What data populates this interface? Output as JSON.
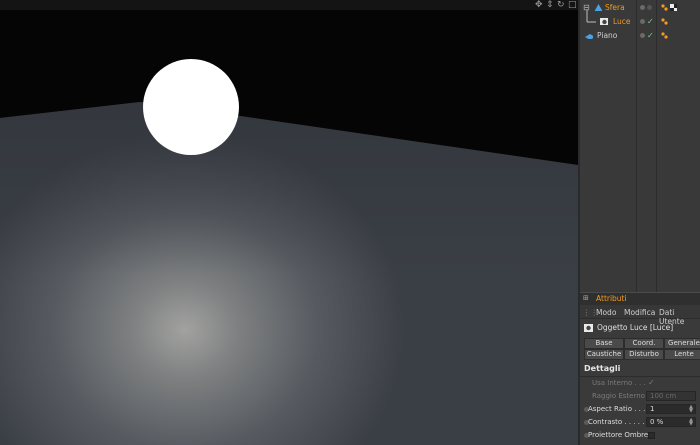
{
  "objects": [
    {
      "name": "Sfera",
      "selected": true,
      "color": "#f29b1d"
    },
    {
      "name": "Luce",
      "selected": true,
      "color": "#f29b1d"
    },
    {
      "name": "Piano",
      "selected": false,
      "color": "#cfcfcf"
    }
  ],
  "attributes": {
    "panel_title": "Attributi",
    "menu": [
      "Modo",
      "Modifica",
      "Dati Utente"
    ],
    "object_title": "Oggetto Luce [Luce]",
    "tabs_row1": [
      "Base",
      "Coord.",
      "Generale"
    ],
    "tabs_row2": [
      "Caustiche",
      "Disturbo",
      "Lente"
    ],
    "section": "Dettagli",
    "params": [
      {
        "label": "Usa Interno . . .",
        "kind": "check",
        "value": "✓",
        "enabled": false
      },
      {
        "label": "Raggio Esterno",
        "kind": "field",
        "value": "100 cm",
        "enabled": false
      },
      {
        "label": "Aspect Ratio . . .",
        "kind": "field",
        "value": "1",
        "enabled": true
      },
      {
        "label": "Contrasto . . . . .",
        "kind": "field",
        "value": "0 %",
        "enabled": true
      },
      {
        "label": "Proiettore Ombre",
        "kind": "box",
        "value": "",
        "enabled": true
      }
    ]
  },
  "colors": {
    "accent": "#f29b1d",
    "sky": "#050505",
    "floor_base": "#3c4148",
    "floor_highlight": "#9a9a9a",
    "sphere": "#ffffff"
  },
  "icons": [
    "move-icon",
    "orbit-icon",
    "zoom-icon",
    "maximize-icon",
    "sphere-object-icon",
    "light-object-icon",
    "plane-object-icon",
    "phong-tag-icon",
    "material-tag-icon"
  ]
}
